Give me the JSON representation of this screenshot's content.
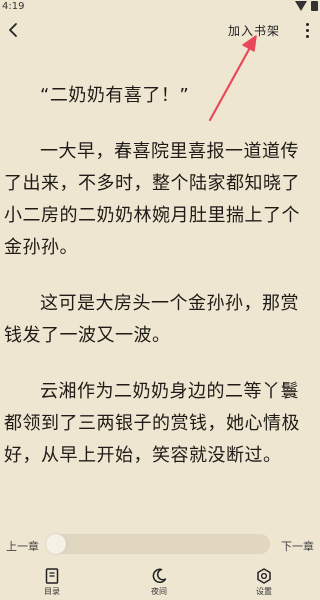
{
  "status": {
    "time": "4:19"
  },
  "header": {
    "add_bookshelf": "加入书架"
  },
  "content": {
    "paragraphs": [
      "“二奶奶有喜了！”",
      "一大早，春喜院里喜报一道道传了出来，不多时，整个陆家都知晓了小二房的二奶奶林婉月肚里揣上了个金孙孙。",
      "这可是大房头一个金孙孙，那赏钱发了一波又一波。",
      "云湘作为二奶奶身边的二等丫鬟都领到了三两银子的赏钱，她心情极好，从早上开始，笑容就没断过。"
    ]
  },
  "chapter_nav": {
    "prev": "上一章",
    "next": "下一章",
    "progress": 0
  },
  "bottom_nav": {
    "catalog": "目录",
    "night": "夜间",
    "settings": "设置"
  },
  "colors": {
    "background": "#efe6d2",
    "annotation_arrow": "#e8495a"
  },
  "icons": [
    "back-arrow-icon",
    "more-vert-icon",
    "catalog-icon",
    "moon-icon",
    "settings-icon",
    "signal-icon",
    "battery-icon"
  ]
}
